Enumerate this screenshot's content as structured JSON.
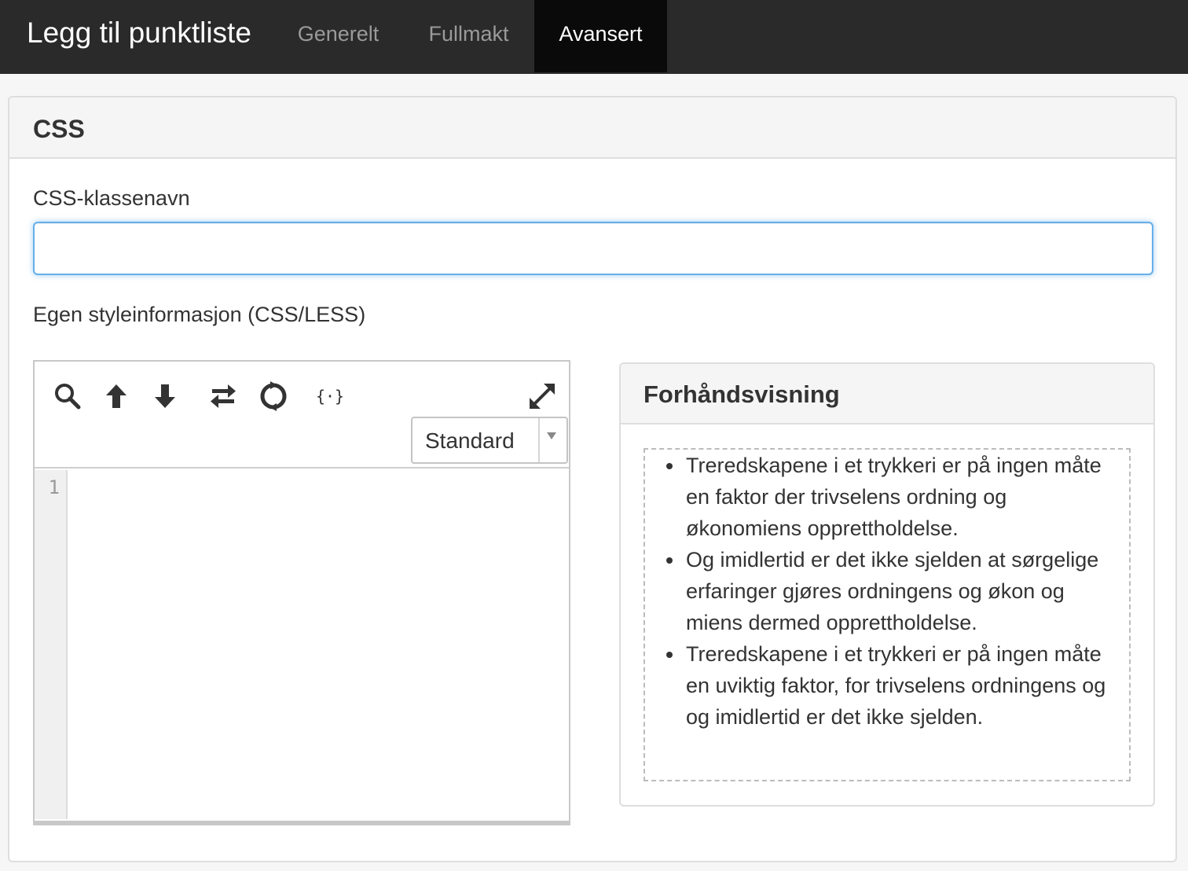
{
  "header": {
    "title": "Legg til punktliste",
    "tabs": [
      {
        "label": "Generelt",
        "active": false
      },
      {
        "label": "Fullmakt",
        "active": false
      },
      {
        "label": "Avansert",
        "active": true
      }
    ]
  },
  "css_panel": {
    "title": "CSS",
    "class_name_label": "CSS-klassenavn",
    "class_name_value": "",
    "style_label": "Egen styleinformasjon (CSS/LESS)"
  },
  "editor": {
    "toolbar_icons": [
      "search-icon",
      "arrow-up-icon",
      "arrow-down-icon",
      "replace-icon",
      "refresh-icon",
      "format-code-icon",
      "expand-icon"
    ],
    "mode_select": {
      "value": "Standard"
    },
    "line_numbers": [
      "1"
    ],
    "content": ""
  },
  "preview": {
    "title": "Forhåndsvisning",
    "items": [
      "Treredskapene i et trykkeri er på ingen måte en faktor der trivselens ordning og økonomiens opprettholdelse.",
      "Og imidlertid er det ikke sjelden at sørgelige erfaringer gjøres ordningens og økon og miens dermed opprettholdelse.",
      "Treredskapene i et trykkeri er på ingen måte en uviktig faktor, for trivselens ordningens og og imidlertid er det ikke sjelden."
    ]
  },
  "colors": {
    "topbar": "#2a2a2a",
    "active_tab": "#0a0a0a",
    "focus_border": "#66afe9"
  }
}
